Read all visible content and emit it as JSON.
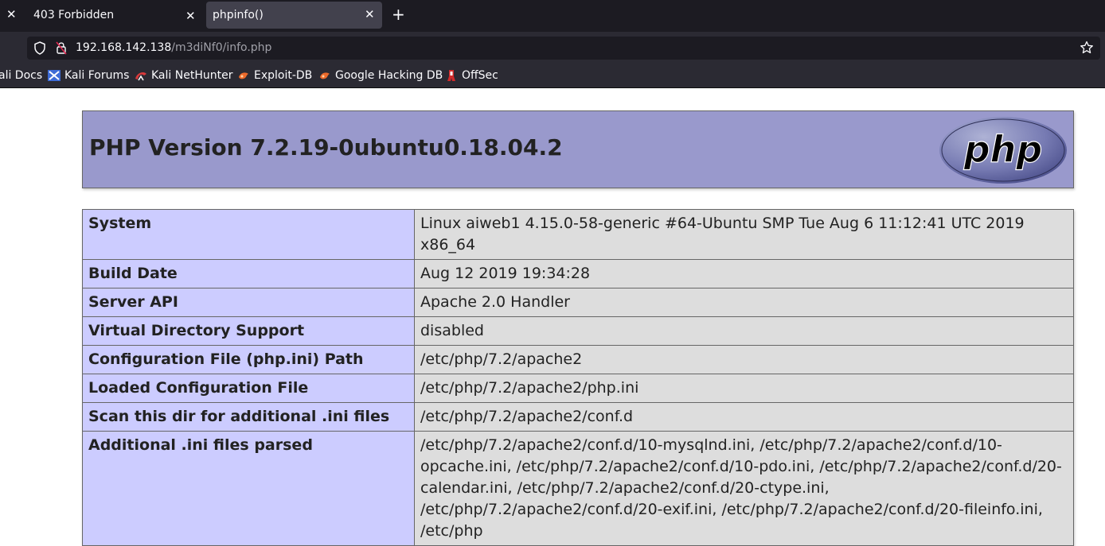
{
  "browser": {
    "tabs": [
      {
        "title": "403 Forbidden"
      },
      {
        "title": "phpinfo()"
      }
    ],
    "url": {
      "host": "192.168.142.138",
      "path": "/m3diNf0/info.php"
    },
    "bookmarks": [
      {
        "label": "ali Docs"
      },
      {
        "label": "Kali Forums"
      },
      {
        "label": "Kali NetHunter"
      },
      {
        "label": "Exploit-DB"
      },
      {
        "label": "Google Hacking DB"
      },
      {
        "label": "OffSec"
      }
    ]
  },
  "phpinfo": {
    "title": "PHP Version 7.2.19-0ubuntu0.18.04.2",
    "logo_text": "php",
    "rows": [
      {
        "key": "System",
        "value": "Linux aiweb1 4.15.0-58-generic #64-Ubuntu SMP Tue Aug 6 11:12:41 UTC 2019 x86_64"
      },
      {
        "key": "Build Date",
        "value": "Aug 12 2019 19:34:28"
      },
      {
        "key": "Server API",
        "value": "Apache 2.0 Handler"
      },
      {
        "key": "Virtual Directory Support",
        "value": "disabled"
      },
      {
        "key": "Configuration File (php.ini) Path",
        "value": "/etc/php/7.2/apache2"
      },
      {
        "key": "Loaded Configuration File",
        "value": "/etc/php/7.2/apache2/php.ini"
      },
      {
        "key": "Scan this dir for additional .ini files",
        "value": "/etc/php/7.2/apache2/conf.d"
      },
      {
        "key": "Additional .ini files parsed",
        "value": "/etc/php/7.2/apache2/conf.d/10-mysqlnd.ini, /etc/php/7.2/apache2/conf.d/10-opcache.ini, /etc/php/7.2/apache2/conf.d/10-pdo.ini, /etc/php/7.2/apache2/conf.d/20-calendar.ini, /etc/php/7.2/apache2/conf.d/20-ctype.ini, /etc/php/7.2/apache2/conf.d/20-exif.ini, /etc/php/7.2/apache2/conf.d/20-fileinfo.ini, /etc/php"
      }
    ]
  }
}
